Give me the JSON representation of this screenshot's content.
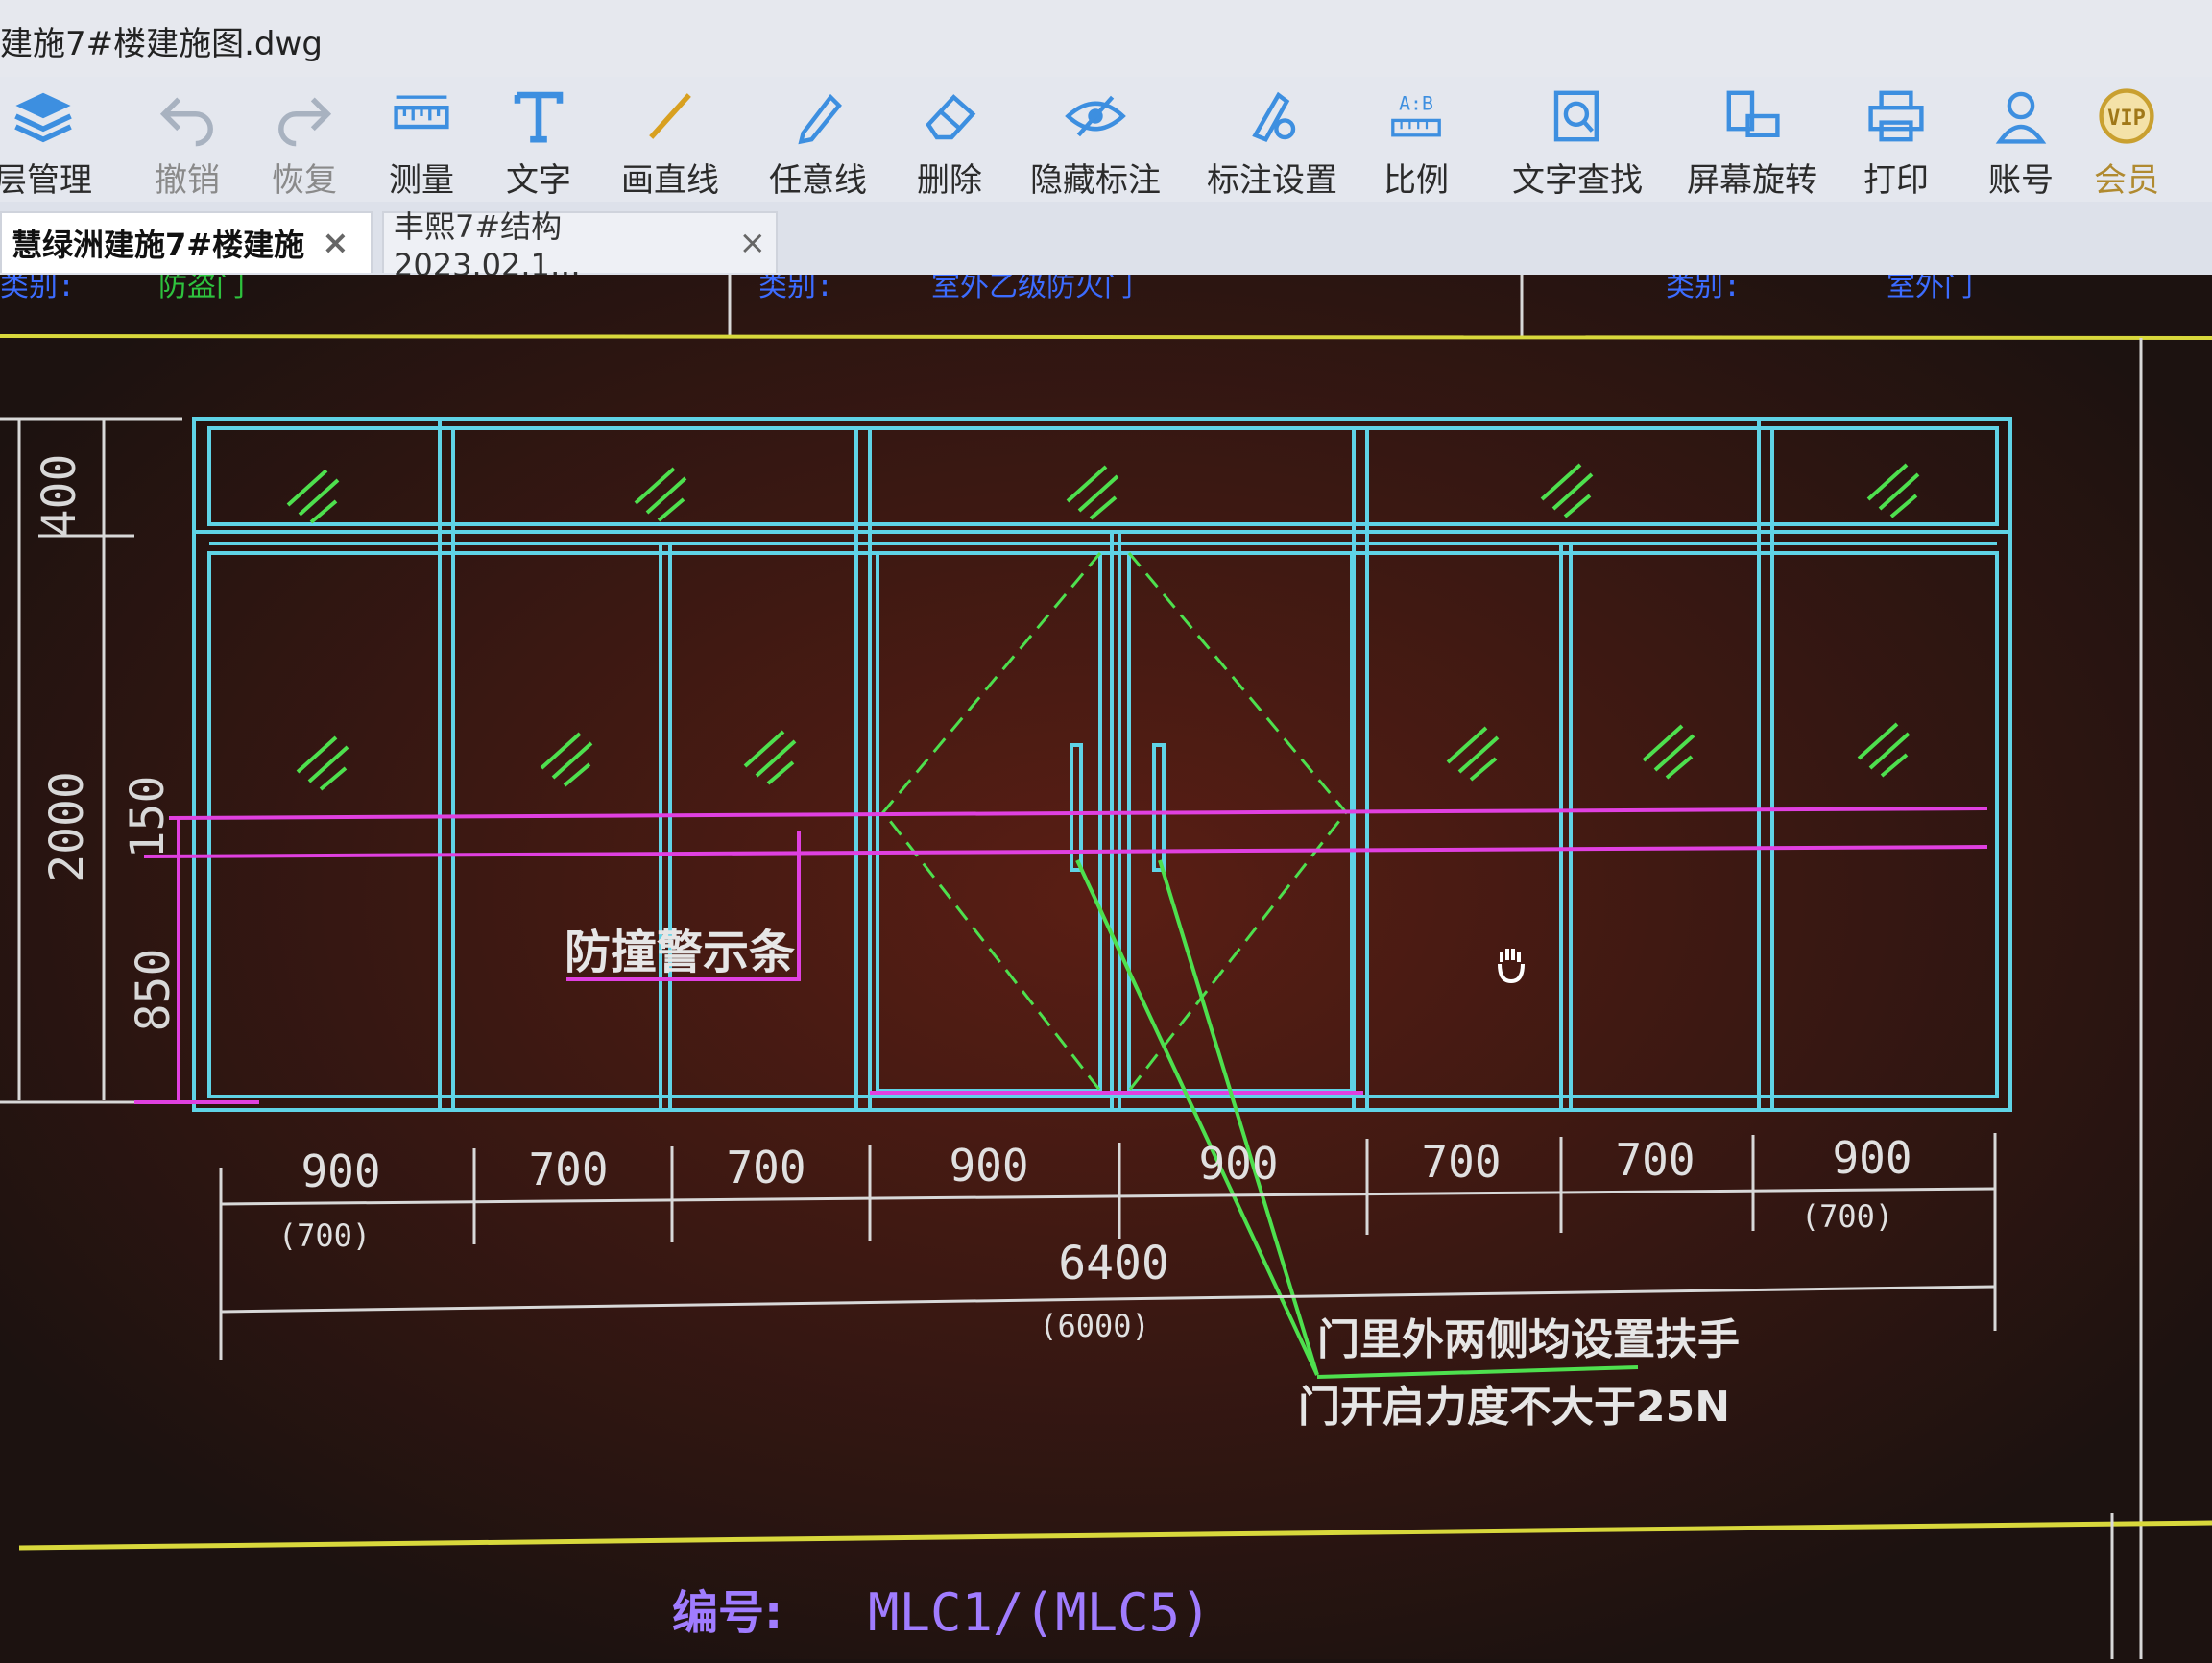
{
  "window": {
    "title": "建施7#楼建施图.dwg"
  },
  "toolbar": {
    "items": [
      {
        "label": "层管理",
        "icon": "layers-icon"
      },
      {
        "label": "撤销",
        "icon": "undo-icon"
      },
      {
        "label": "恢复",
        "icon": "redo-icon"
      },
      {
        "label": "测量",
        "icon": "ruler-icon"
      },
      {
        "label": "文字",
        "icon": "text-icon"
      },
      {
        "label": "画直线",
        "icon": "line-icon"
      },
      {
        "label": "任意线",
        "icon": "pen-icon"
      },
      {
        "label": "删除",
        "icon": "eraser-icon"
      },
      {
        "label": "隐藏标注",
        "icon": "eye-hidden-icon"
      },
      {
        "label": "标注设置",
        "icon": "annotation-settings-icon"
      },
      {
        "label": "比例",
        "icon": "scale-icon"
      },
      {
        "label": "文字查找",
        "icon": "text-search-icon"
      },
      {
        "label": "屏幕旋转",
        "icon": "screen-rotate-icon"
      },
      {
        "label": "打印",
        "icon": "printer-icon"
      },
      {
        "label": "账号",
        "icon": "user-icon"
      },
      {
        "label": "会员",
        "icon": "vip-icon"
      }
    ]
  },
  "tabs": [
    {
      "label": "慧绿洲建施7#楼建施",
      "close": "×"
    },
    {
      "label": "丰熙7#结构2023.02.1…",
      "close": "×"
    }
  ],
  "drawing": {
    "header_cells": [
      "类别:",
      "防盗门",
      "类别:",
      "室外乙级防火门",
      "类别:",
      "室外门"
    ],
    "vertical_dims": [
      "400",
      "2000",
      "150",
      "850"
    ],
    "bottom_dims": [
      "900",
      "700",
      "700",
      "900",
      "900",
      "700",
      "700",
      "900"
    ],
    "bottom_dim_alts": [
      "(700)",
      "(700)"
    ],
    "total_width": "6400",
    "total_width_alt": "(6000)",
    "label_warning_strip": "防撞警示条",
    "note_line1": "门里外两侧均设置扶手",
    "note_line2": "门开启力度不大于25N",
    "id_label": "编号:",
    "id_value": "MLC1/(MLC5)",
    "glass_mark": "//"
  },
  "colors": {
    "frame": "#5fd3e6",
    "dims": "#d8d8d8",
    "magenta": "#e040e0",
    "green": "#4ee04e",
    "yellow": "#d8d83c",
    "purple_text": "#a07cff",
    "background": "#1c1210"
  }
}
